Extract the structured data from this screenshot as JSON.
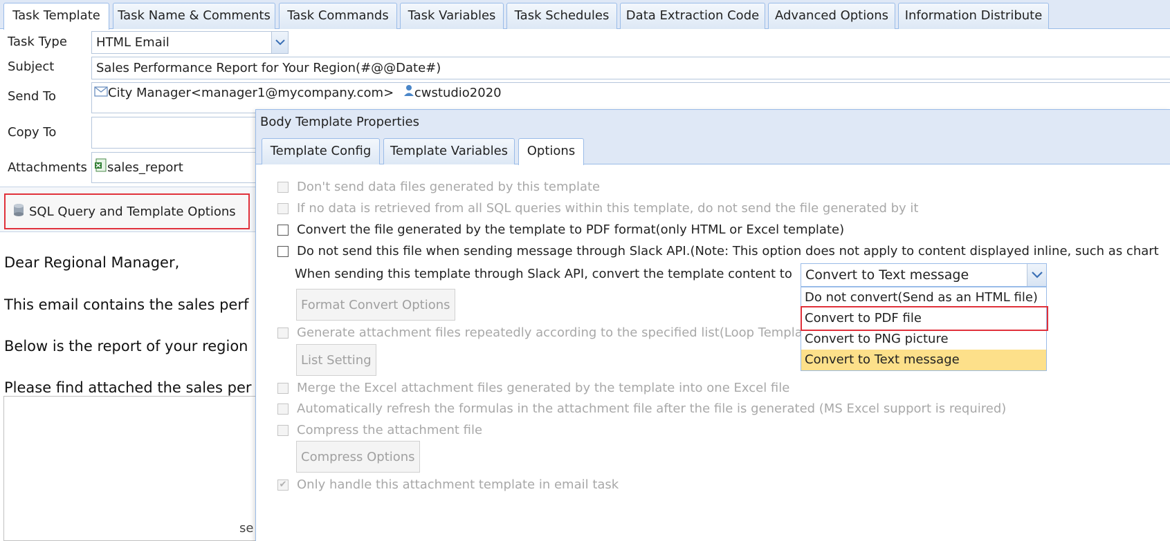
{
  "top_tabs": [
    {
      "label": "Task Template",
      "active": true
    },
    {
      "label": "Task Name & Comments",
      "active": false
    },
    {
      "label": "Task Commands",
      "active": false
    },
    {
      "label": "Task Variables",
      "active": false
    },
    {
      "label": "Task Schedules",
      "active": false
    },
    {
      "label": "Data Extraction Code",
      "active": false
    },
    {
      "label": "Advanced Options",
      "active": false
    },
    {
      "label": "Information Distribute",
      "active": false
    }
  ],
  "form": {
    "task_type_label": "Task Type",
    "task_type_value": "HTML Email",
    "subject_label": "Subject",
    "subject_value": "Sales Performance Report for Your Region(#@@Date#)",
    "send_to_label": "Send To",
    "send_to_recipient": "City Manager<manager1@mycompany.com>",
    "send_to_user": "cwstudio2020",
    "copy_to_label": "Copy To",
    "attachments_label": "Attachments",
    "attachment_name": "sales_report"
  },
  "toolbar": {
    "sql_button_label": "SQL Query and Template Options"
  },
  "email_body": {
    "line1": "Dear Regional Manager,",
    "line2": "This email contains the sales perf",
    "line3": "Below is the report of your region",
    "line4": "Please find attached the sales per",
    "fragment": "se"
  },
  "dialog": {
    "title": "Body Template Properties",
    "tabs": [
      {
        "label": "Template Config",
        "active": false
      },
      {
        "label": "Template Variables",
        "active": false
      },
      {
        "label": "Options",
        "active": true
      }
    ],
    "options": {
      "opt1": "Don't send data files generated by this template",
      "opt2": "If no data is retrieved from all SQL queries within this template, do not send the file generated by it",
      "opt3": "Convert the file generated by the template to PDF format(only HTML or Excel template)",
      "opt4": "Do not send this file when sending message through Slack API.(Note: This option does not apply to content displayed inline, such as chart",
      "slack_convert_label": "When sending this template through Slack API, convert the template content to",
      "format_convert_button": "Format Convert Options",
      "opt5": "Generate attachment files repeatedly according to the specified list(Loop Templa",
      "list_setting_button": "List Setting",
      "opt6": "Merge the Excel attachment files generated by the template into one Excel file",
      "opt7": "Automatically refresh the formulas in the attachment file after the file is generated (MS Excel support is required)",
      "opt8": "Compress the attachment file",
      "compress_options_button": "Compress Options",
      "opt9": "Only handle this attachment template in email task"
    },
    "slack_select": {
      "value": "Convert to Text message",
      "options": [
        {
          "label": "Do not convert(Send as an HTML file)",
          "selected": false
        },
        {
          "label": "Convert to PDF file",
          "selected": false
        },
        {
          "label": "Convert to PNG picture",
          "selected": false
        },
        {
          "label": "Convert to Text message",
          "selected": true
        }
      ]
    }
  },
  "colors": {
    "highlight_red": "#e0303a",
    "selected_option": "#fde08a",
    "tab_border": "#99bbe8"
  }
}
